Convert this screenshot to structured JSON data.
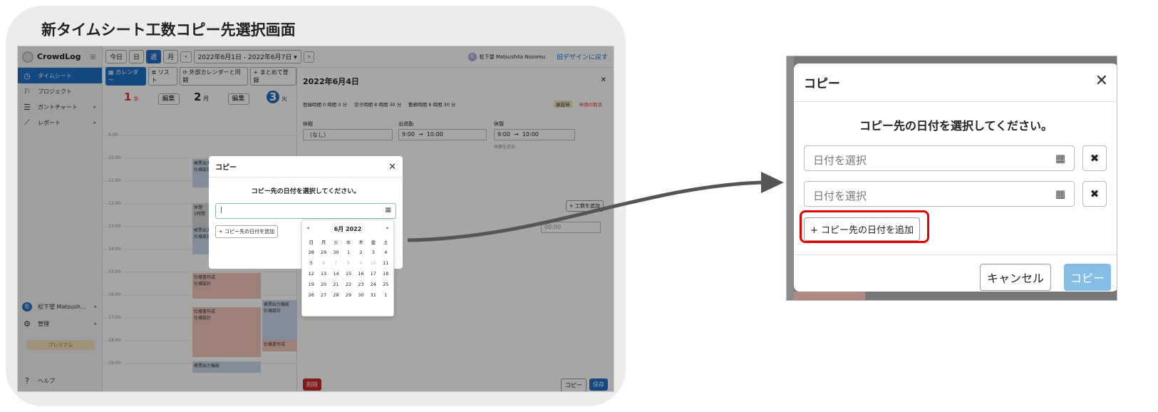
{
  "header_title": "新タイムシート工数コピー先選択画面",
  "app": {
    "logo": "CrowdLog",
    "menu_icon": "≡",
    "sidebar": [
      {
        "label": "タイムシート",
        "icon": "clock-icon",
        "active": true
      },
      {
        "label": "プロジェクト",
        "icon": "flag-icon"
      },
      {
        "label": "ガントチャート",
        "icon": "list-icon"
      },
      {
        "label": "レポート",
        "icon": "chart-icon"
      }
    ],
    "user_name": "松下望 Matsush...",
    "user_initial": "松",
    "admin": "管理",
    "premium": "プレミアム",
    "help": "ヘルプ",
    "toolbar": {
      "today": "今日",
      "day": "日",
      "week": "週",
      "month": "月",
      "prev": "‹",
      "next": "›",
      "range": "2022年6月1日 - 2022年6月7日 ▾"
    },
    "user_full": "松下望 Matsushita Nozomu",
    "back_old": "旧デザインに戻す",
    "cal_bar": {
      "calendar": "▦ カレンダー",
      "list": "≣ リスト",
      "sync": "⟳ 外部カレンダーと同期",
      "bulk": "+ まとめて登録"
    },
    "days": [
      {
        "num": "1",
        "wd": "水",
        "edit": "編集"
      },
      {
        "num": "2",
        "wd": "月",
        "edit": "編集"
      },
      {
        "num": "3",
        "wd": "火"
      }
    ],
    "hours": [
      "9:00",
      "10:00",
      "11:00",
      "12:00",
      "13:00",
      "14:00",
      "15:00",
      "16:00",
      "17:00",
      "18:00",
      "19:00"
    ],
    "events": [
      {
        "title": "帳票出力",
        "sub": "仕様設計"
      },
      {
        "title": "休憩",
        "sub": "1時間"
      },
      {
        "title": "帳票出力",
        "sub": "仕様設計"
      },
      {
        "title": "仕様書作成",
        "sub": "仕様設計"
      },
      {
        "title": "仕様書作成",
        "sub": "仕様設計"
      },
      {
        "title": "帳票出力機能",
        "sub": ""
      },
      {
        "title": "帳票出力機能",
        "sub": "仕様設計"
      },
      {
        "title": "仕様書作成",
        "sub": ""
      }
    ],
    "detail": {
      "title": "2022年6月4日",
      "reg": "登録時間 0 時間 0 分",
      "free": "空き時間 8 時間 30 分",
      "work": "勤務時間 8 時間 30 分",
      "status": "承認待",
      "apply": "申請の取消",
      "leave_label": "休暇",
      "leave_value": "（なし）",
      "attend_label": "出退勤",
      "attend_from": "9:00",
      "attend_to": "10:00",
      "break_label": "休憩",
      "break_from": "9:00",
      "break_to": "10:00",
      "break_add": "休憩を追加",
      "add_work": "+ 工数を追加",
      "time": "00:00",
      "delete": "削除",
      "copy": "コピー",
      "save": "保存"
    },
    "mini_dialog": {
      "title": "コピー",
      "msg": "コピー先の日付を選択してください。",
      "input": "|",
      "add": "+ コピー先の日付を追加"
    },
    "datepicker": {
      "month": "6月 2022",
      "weekdays": [
        "日",
        "月",
        "火",
        "水",
        "木",
        "金",
        "土"
      ],
      "weeks": [
        [
          "28",
          "29",
          "30",
          "1",
          "2",
          "3",
          "4"
        ],
        [
          "5",
          "6",
          "7",
          "8",
          "9",
          "10",
          "11"
        ],
        [
          "12",
          "13",
          "14",
          "15",
          "16",
          "17",
          "18"
        ],
        [
          "19",
          "20",
          "21",
          "22",
          "23",
          "24",
          "25"
        ],
        [
          "26",
          "27",
          "28",
          "29",
          "30",
          "31",
          "1"
        ]
      ]
    }
  },
  "zoom": {
    "title": "コピー",
    "close": "✕",
    "message": "コピー先の日付を選択してください。",
    "date_placeholder": "日付を選択",
    "delete": "✖",
    "add": "+ コピー先の日付を追加",
    "cancel": "キャンセル",
    "copy": "コピー"
  }
}
